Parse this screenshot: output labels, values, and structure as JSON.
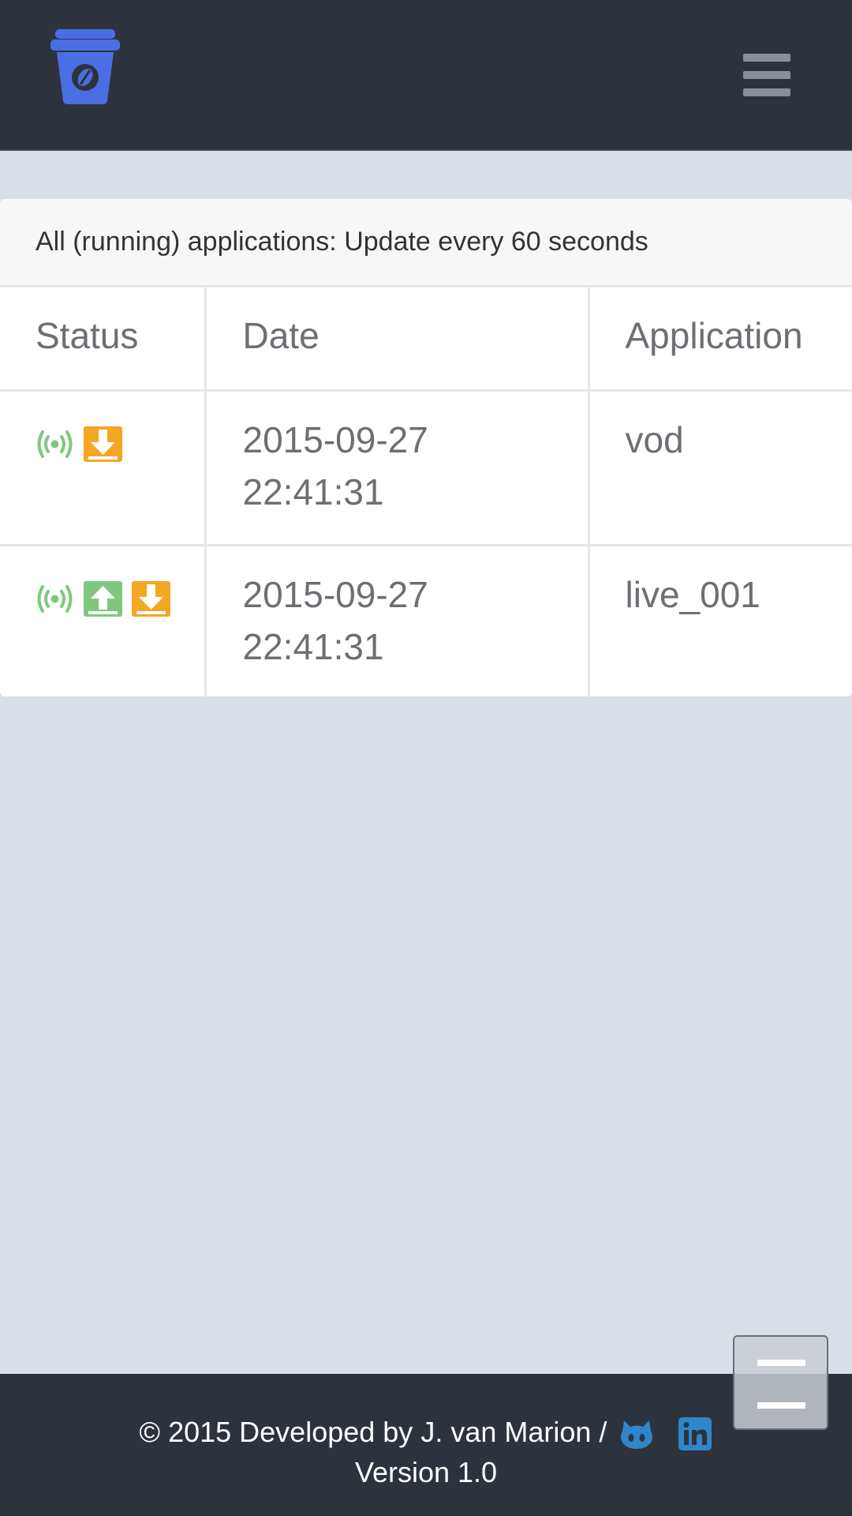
{
  "navbar": {
    "logo_icon": "coffee-cup-icon",
    "menu_icon": "hamburger-menu-icon"
  },
  "panel": {
    "heading": "All (running) applications: Update every 60 seconds"
  },
  "table": {
    "headers": [
      "Status",
      "Date",
      "Application"
    ],
    "rows": [
      {
        "status_icons": [
          "broadcast-icon",
          "download-icon"
        ],
        "date_line1": "2015-09-27",
        "date_line2": "22:41:31",
        "application": "vod"
      },
      {
        "status_icons": [
          "broadcast-icon",
          "upload-icon",
          "download-icon"
        ],
        "date_line1": "2015-09-27",
        "date_line2": "22:41:31",
        "application": "live_001"
      }
    ]
  },
  "footer": {
    "copyright": "© 2015 Developed by J. van Marion /",
    "version": "Version 1.0",
    "links": [
      "github-icon",
      "linkedin-icon"
    ]
  },
  "colors": {
    "navbar_bg": "#2d333c",
    "page_bg": "#d9dfe7",
    "logo_blue": "#4a6fe3",
    "status_green": "#7fc77f",
    "status_orange": "#f5a623",
    "link_blue": "#2f86c8"
  }
}
